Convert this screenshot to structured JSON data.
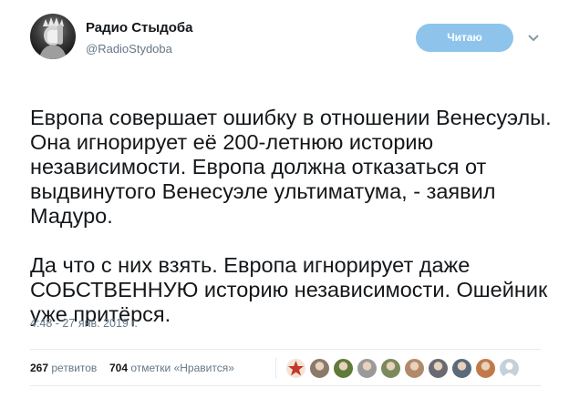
{
  "account": {
    "name": "Радио Стыдоба",
    "handle": "@RadioStydoba",
    "avatar_icon": "statue-of-liberty-facepalm-avatar"
  },
  "follow_button": {
    "label": "Читаю",
    "color": "#8ec4ec"
  },
  "tweet": {
    "lines": [
      "Европа совершает ошибку в отношении Венесуэлы. Она игнорирует её 200-летнюю историю независимости. Европа должна отказаться от выдвинутого Венесуэле ультиматума, - заявил Мадуро.",
      "Да что с них взять. Европа игнорирует даже СОБСТВЕННУЮ историю независимости. Ошейник уже притёрся."
    ],
    "timestamp": "4:48 - 27 янв. 2019 г."
  },
  "stats": {
    "retweets_count": "267",
    "retweets_label": "ретвитов",
    "likes_count": "704",
    "likes_label": "отметки «Нравится»"
  },
  "liker_avatars": [
    {
      "name": "soviet-star-avatar",
      "color": "#c0392b"
    },
    {
      "name": "portrait-avatar-1",
      "color": "#8a7a6a"
    },
    {
      "name": "cartoon-avatar",
      "color": "#5f7a3a"
    },
    {
      "name": "portrait-avatar-2",
      "color": "#9a9a9a"
    },
    {
      "name": "portrait-avatar-3",
      "color": "#7a8a5a"
    },
    {
      "name": "portrait-avatar-4",
      "color": "#b08a6a"
    },
    {
      "name": "portrait-avatar-5",
      "color": "#6a6a72"
    },
    {
      "name": "portrait-avatar-6",
      "color": "#5a6a7a"
    },
    {
      "name": "portrait-avatar-7",
      "color": "#c07a4a"
    },
    {
      "name": "default-avatar",
      "color": "#c5d0d9"
    }
  ]
}
